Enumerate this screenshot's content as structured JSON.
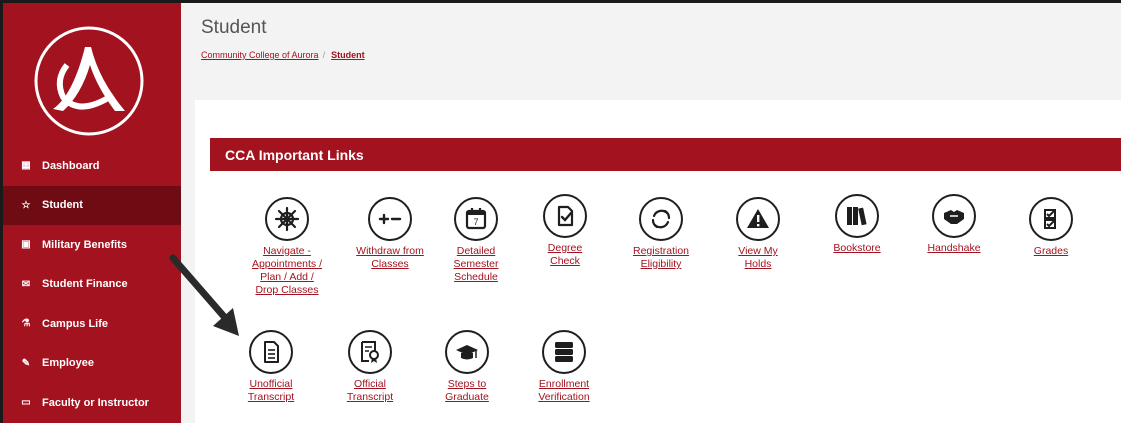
{
  "sidebar": {
    "items": [
      {
        "label": "Dashboard",
        "icon": "dashboard-grid-icon",
        "glyph": "▦"
      },
      {
        "label": "Student",
        "icon": "star-icon",
        "glyph": "☆"
      },
      {
        "label": "Military Benefits",
        "icon": "id-card-icon",
        "glyph": "▣"
      },
      {
        "label": "Student Finance",
        "icon": "envelope-icon",
        "glyph": "✉"
      },
      {
        "label": "Campus Life",
        "icon": "flask-icon",
        "glyph": "⚗"
      },
      {
        "label": "Employee",
        "icon": "edit-icon",
        "glyph": "✎"
      },
      {
        "label": "Faculty or Instructor",
        "icon": "monitor-icon",
        "glyph": "▭"
      }
    ]
  },
  "header": {
    "title": "Student",
    "breadcrumb": {
      "home": "Community College of Aurora",
      "separator": "/",
      "current": "Student"
    }
  },
  "section": {
    "title": "CCA Important Links"
  },
  "links": [
    {
      "label": "Navigate -\nAppointments /\nPlan / Add /\nDrop Classes",
      "icon": "ship-wheel-icon"
    },
    {
      "label": "Withdraw from\nClasses",
      "icon": "plus-minus-icon"
    },
    {
      "label": "Detailed\nSemester\nSchedule",
      "icon": "calendar-icon"
    },
    {
      "label": "Degree\nCheck",
      "icon": "document-check-icon"
    },
    {
      "label": "Registration\nEligibility",
      "icon": "refresh-icon"
    },
    {
      "label": "View My\nHolds",
      "icon": "warning-icon"
    },
    {
      "label": "Bookstore",
      "icon": "books-icon"
    },
    {
      "label": "Handshake",
      "icon": "handshake-icon"
    },
    {
      "label": "Grades",
      "icon": "checklist-icon"
    },
    {
      "label": "Unofficial\nTranscript",
      "icon": "file-icon"
    },
    {
      "label": "Official\nTranscript",
      "icon": "certificate-icon"
    },
    {
      "label": "Steps to\nGraduate",
      "icon": "graduation-cap-icon"
    },
    {
      "label": "Enrollment\nVerification",
      "icon": "server-icon"
    }
  ],
  "colors": {
    "brand": "#a3121f",
    "brand_dark": "#6e0b13",
    "text": "#555555"
  }
}
